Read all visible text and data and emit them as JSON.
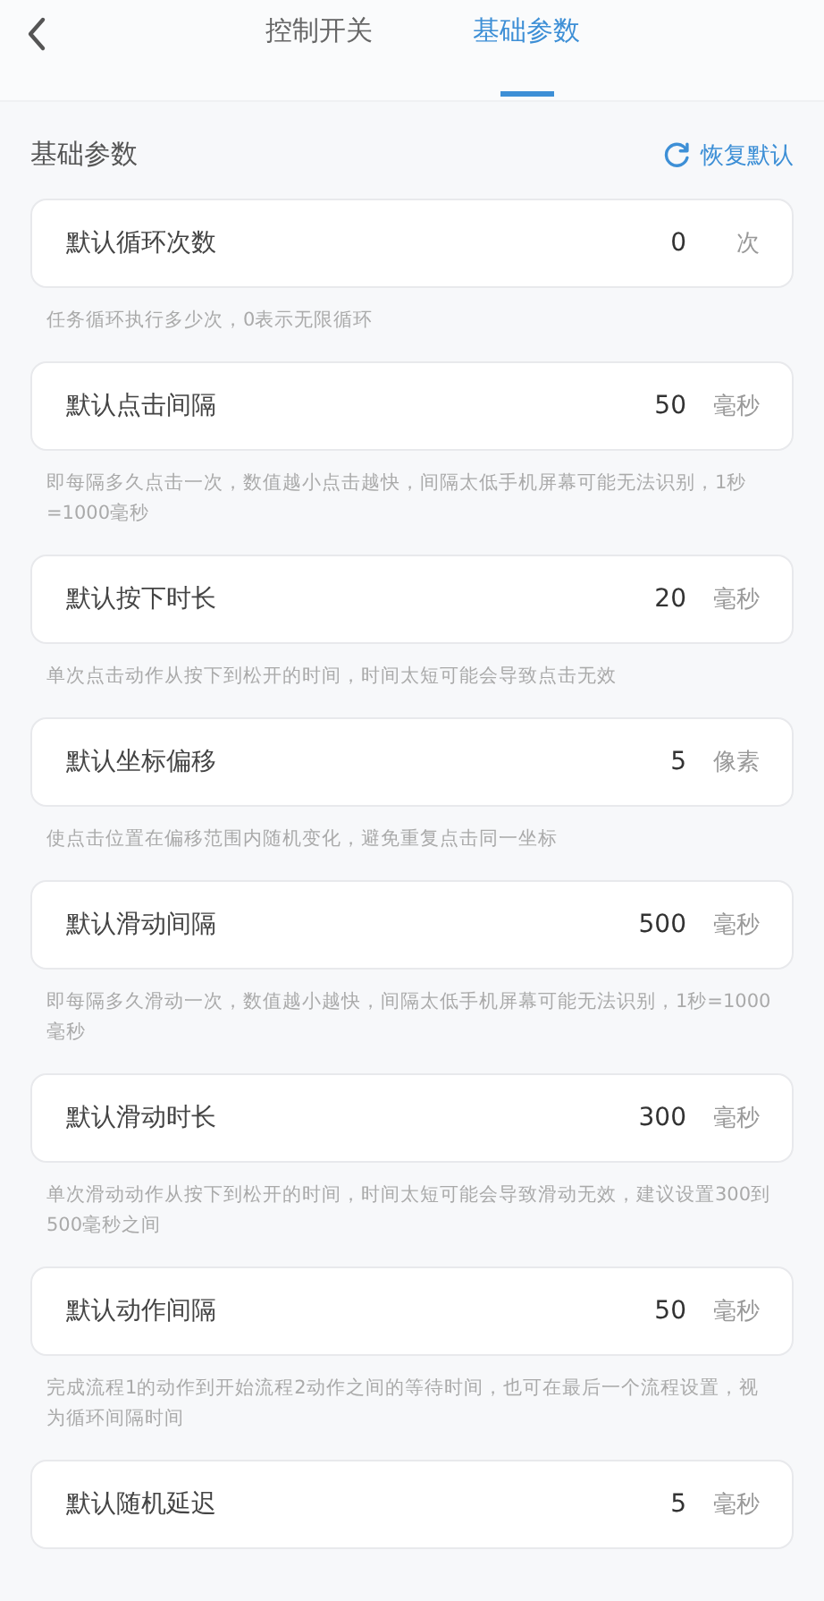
{
  "tabs": [
    {
      "label": "控制开关",
      "selected": false
    },
    {
      "label": "基础参数",
      "selected": true
    }
  ],
  "section": {
    "title": "基础参数",
    "reset_label": "恢复默认"
  },
  "params": [
    {
      "label": "默认循环次数",
      "value": "0",
      "unit": "次",
      "hint": "任务循环执行多少次，0表示无限循环"
    },
    {
      "label": "默认点击间隔",
      "value": "50",
      "unit": "毫秒",
      "hint": "即每隔多久点击一次，数值越小点击越快，间隔太低手机屏幕可能无法识别，1秒=1000毫秒"
    },
    {
      "label": "默认按下时长",
      "value": "20",
      "unit": "毫秒",
      "hint": "单次点击动作从按下到松开的时间，时间太短可能会导致点击无效"
    },
    {
      "label": "默认坐标偏移",
      "value": "5",
      "unit": "像素",
      "hint": "使点击位置在偏移范围内随机变化，避免重复点击同一坐标"
    },
    {
      "label": "默认滑动间隔",
      "value": "500",
      "unit": "毫秒",
      "hint": "即每隔多久滑动一次，数值越小越快，间隔太低手机屏幕可能无法识别，1秒=1000毫秒"
    },
    {
      "label": "默认滑动时长",
      "value": "300",
      "unit": "毫秒",
      "hint": "单次滑动动作从按下到松开的时间，时间太短可能会导致滑动无效，建议设置300到500毫秒之间"
    },
    {
      "label": "默认动作间隔",
      "value": "50",
      "unit": "毫秒",
      "hint": "完成流程1的动作到开始流程2动作之间的等待时间，也可在最后一个流程设置，视为循环间隔时间"
    },
    {
      "label": "默认随机延迟",
      "value": "5",
      "unit": "毫秒"
    }
  ]
}
